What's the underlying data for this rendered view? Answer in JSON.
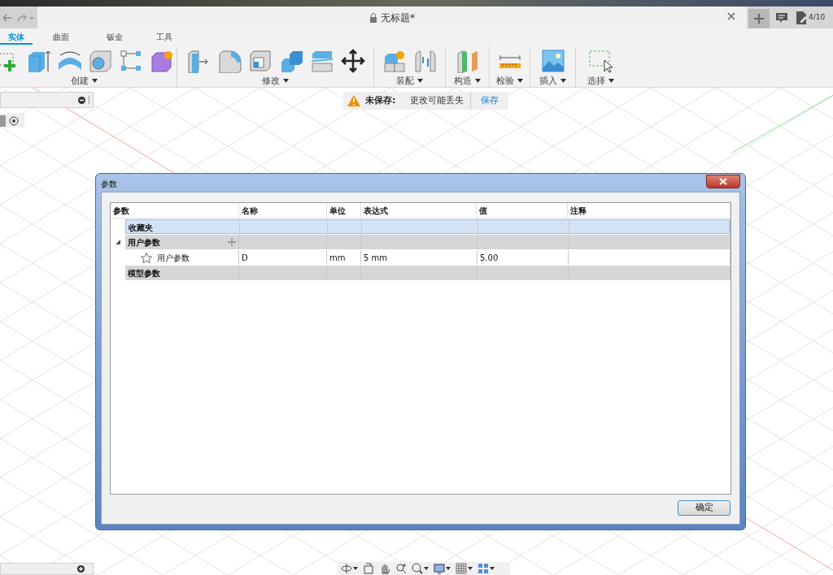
{
  "document_tab": {
    "title": "无标题*"
  },
  "job_status": "4/10",
  "ribbon": {
    "tabs": [
      {
        "label": "实体",
        "selected": true
      },
      {
        "label": "曲面",
        "selected": false
      },
      {
        "label": "钣金",
        "selected": false
      },
      {
        "label": "工具",
        "selected": false
      }
    ],
    "groups": [
      {
        "label": "创建"
      },
      {
        "label": "修改"
      },
      {
        "label": "装配"
      },
      {
        "label": "构造"
      },
      {
        "label": "检验"
      },
      {
        "label": "插入"
      },
      {
        "label": "选择"
      }
    ]
  },
  "unsaved_banner": {
    "label": "未保存:",
    "message": "更改可能丢失",
    "action": "保存"
  },
  "dialog": {
    "title": "参数",
    "columns": [
      "参数",
      "名称",
      "单位",
      "表达式",
      "值",
      "注释"
    ],
    "rows": [
      {
        "kind": "favorites",
        "label": "收藏夹",
        "selected": true
      },
      {
        "kind": "group",
        "label": "用户参数",
        "selected": false,
        "expanded": true,
        "children": [
          {
            "label": "用户参数",
            "favorite": false,
            "name": "D",
            "unit": "mm",
            "expression": "5 mm",
            "value": "5.00"
          }
        ]
      },
      {
        "kind": "group",
        "label": "模型参数",
        "selected": false
      }
    ],
    "ok_button": "确定"
  }
}
